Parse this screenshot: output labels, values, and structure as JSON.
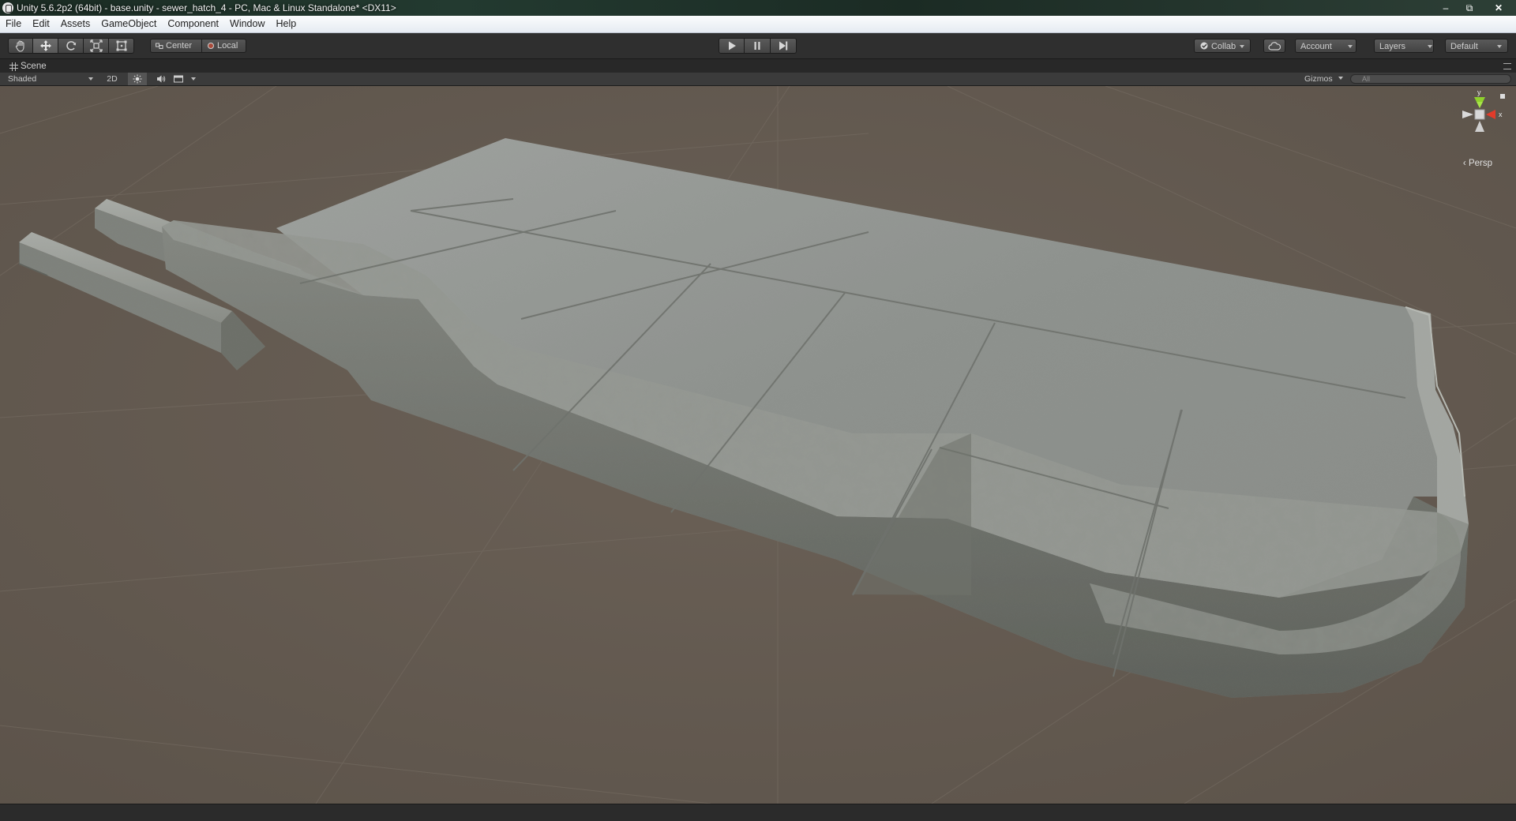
{
  "window": {
    "title": "Unity 5.6.2p2 (64bit) - base.unity - sewer_hatch_4 - PC, Mac & Linux Standalone* <DX11>",
    "minimize_glyph": "–",
    "maximize_glyph": "⧉",
    "close_glyph": "✕"
  },
  "menu": [
    "File",
    "Edit",
    "Assets",
    "GameObject",
    "Component",
    "Window",
    "Help"
  ],
  "toolbar": {
    "tools": [
      {
        "name": "hand-tool",
        "icon": "hand-icon",
        "active": false
      },
      {
        "name": "move-tool",
        "icon": "move-icon",
        "active": true
      },
      {
        "name": "rotate-tool",
        "icon": "rotate-icon",
        "active": false
      },
      {
        "name": "scale-tool",
        "icon": "scale-icon",
        "active": false
      },
      {
        "name": "rect-tool",
        "icon": "rect-tool-icon",
        "active": false
      }
    ],
    "pivot_mode": "Center",
    "pivot_rotation": "Local",
    "collab_label": "Collab",
    "account_label": "Account",
    "layers_label": "Layers",
    "layout_label": "Default"
  },
  "scene_tab": {
    "label": "Scene"
  },
  "scene_controls": {
    "shading_mode": "Shaded",
    "mode_2d": "2D",
    "gizmos_label": "Gizmos",
    "search_placeholder": "All"
  },
  "scene_gizmo": {
    "y_label": "y",
    "x_label": "x",
    "projection_label": "Persp"
  },
  "colors": {
    "viewport_background": "#645a50",
    "toolbar_background": "#2f2f2f",
    "gizmo_y": "#8fd12c",
    "gizmo_x": "#e23b2a"
  }
}
